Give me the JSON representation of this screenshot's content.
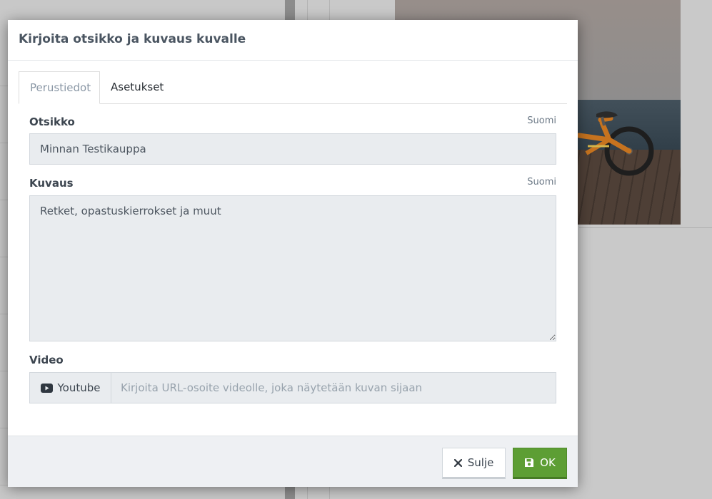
{
  "dialog": {
    "title": "Kirjoita otsikko ja kuvaus kuvalle"
  },
  "tabs": [
    {
      "label": "Perustiedot",
      "active": true
    },
    {
      "label": "Asetukset",
      "active": false
    }
  ],
  "fields": {
    "title": {
      "label": "Otsikko",
      "language": "Suomi",
      "value": "Minnan Testikauppa"
    },
    "description": {
      "label": "Kuvaus",
      "language": "Suomi",
      "value": "Retket, opastuskierrokset ja muut"
    },
    "video": {
      "label": "Video",
      "provider_label": "Youtube",
      "provider_icon": "youtube-icon",
      "value": "",
      "placeholder": "Kirjoita URL-osoite videolle, joka näytetään kuvan sijaan"
    }
  },
  "footer": {
    "close_label": "Sulje",
    "close_icon": "close-icon",
    "ok_label": "OK",
    "ok_icon": "save-icon"
  },
  "colors": {
    "ok_button": "#5d9e34",
    "input_background": "#e9ecef",
    "active_tab_text": "#8a97a5"
  }
}
